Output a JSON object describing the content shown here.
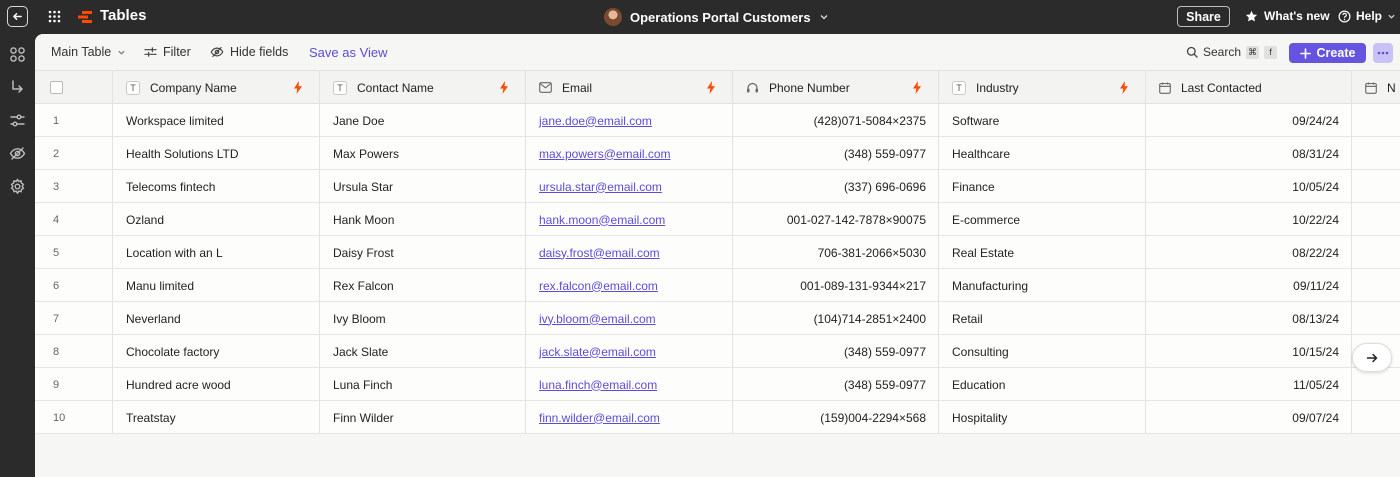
{
  "app": {
    "title": "Tables",
    "brand_color": "#ff4a00"
  },
  "header": {
    "page_title": "Operations Portal Customers",
    "share_label": "Share",
    "whats_new_label": "What's new",
    "help_label": "Help"
  },
  "toolbar": {
    "view_label": "Main Table",
    "filter_label": "Filter",
    "hide_fields_label": "Hide fields",
    "save_view_label": "Save as View",
    "search_label": "Search",
    "search_shortcut": [
      "⌘",
      "f"
    ],
    "create_label": "Create",
    "accent_color": "#6554e0"
  },
  "table": {
    "columns": [
      {
        "label": "Company Name",
        "icon": "text-type-icon"
      },
      {
        "label": "Contact Name",
        "icon": "text-type-icon"
      },
      {
        "label": "Email",
        "icon": "email-type-icon"
      },
      {
        "label": "Phone Number",
        "icon": "phone-type-icon"
      },
      {
        "label": "Industry",
        "icon": "text-type-icon"
      },
      {
        "label": "Last Contacted",
        "icon": "date-type-icon"
      },
      {
        "label": "N",
        "icon": "date-type-icon"
      }
    ],
    "rows": [
      {
        "num": "1",
        "company": "Workspace limited",
        "contact": "Jane Doe",
        "email": "jane.doe@email.com",
        "phone": "(428)071-5084×2375",
        "industry": "Software",
        "last": "09/24/24"
      },
      {
        "num": "2",
        "company": "Health Solutions LTD",
        "contact": "Max Powers",
        "email": "max.powers@email.com",
        "phone": "(348) 559-0977",
        "industry": "Healthcare",
        "last": "08/31/24"
      },
      {
        "num": "3",
        "company": "Telecoms fintech",
        "contact": "Ursula Star",
        "email": "ursula.star@email.com",
        "phone": "(337) 696-0696",
        "industry": "Finance",
        "last": "10/05/24"
      },
      {
        "num": "4",
        "company": "Ozland",
        "contact": "Hank Moon",
        "email": "hank.moon@email.com",
        "phone": "001-027-142-7878×90075",
        "industry": "E-commerce",
        "last": "10/22/24"
      },
      {
        "num": "5",
        "company": "Location with an L",
        "contact": "Daisy Frost",
        "email": "daisy.frost@email.com",
        "phone": "706-381-2066×5030",
        "industry": "Real Estate",
        "last": "08/22/24"
      },
      {
        "num": "6",
        "company": "Manu limited",
        "contact": "Rex Falcon",
        "email": "rex.falcon@email.com",
        "phone": "001-089-131-9344×217",
        "industry": "Manufacturing",
        "last": "09/11/24"
      },
      {
        "num": "7",
        "company": "Neverland",
        "contact": "Ivy Bloom",
        "email": "ivy.bloom@email.com",
        "phone": "(104)714-2851×2400",
        "industry": "Retail",
        "last": "08/13/24"
      },
      {
        "num": "8",
        "company": "Chocolate factory",
        "contact": "Jack Slate",
        "email": "jack.slate@email.com",
        "phone": "(348) 559-0977",
        "industry": "Consulting",
        "last": "10/15/24"
      },
      {
        "num": "9",
        "company": "Hundred acre wood",
        "contact": "Luna Finch",
        "email": "luna.finch@email.com",
        "phone": "(348) 559-0977",
        "industry": "Education",
        "last": "11/05/24"
      },
      {
        "num": "10",
        "company": "Treatstay",
        "contact": "Finn Wilder",
        "email": "finn.wilder@email.com",
        "phone": "(159)004-2294×568",
        "industry": "Hospitality",
        "last": "09/07/24"
      }
    ]
  }
}
